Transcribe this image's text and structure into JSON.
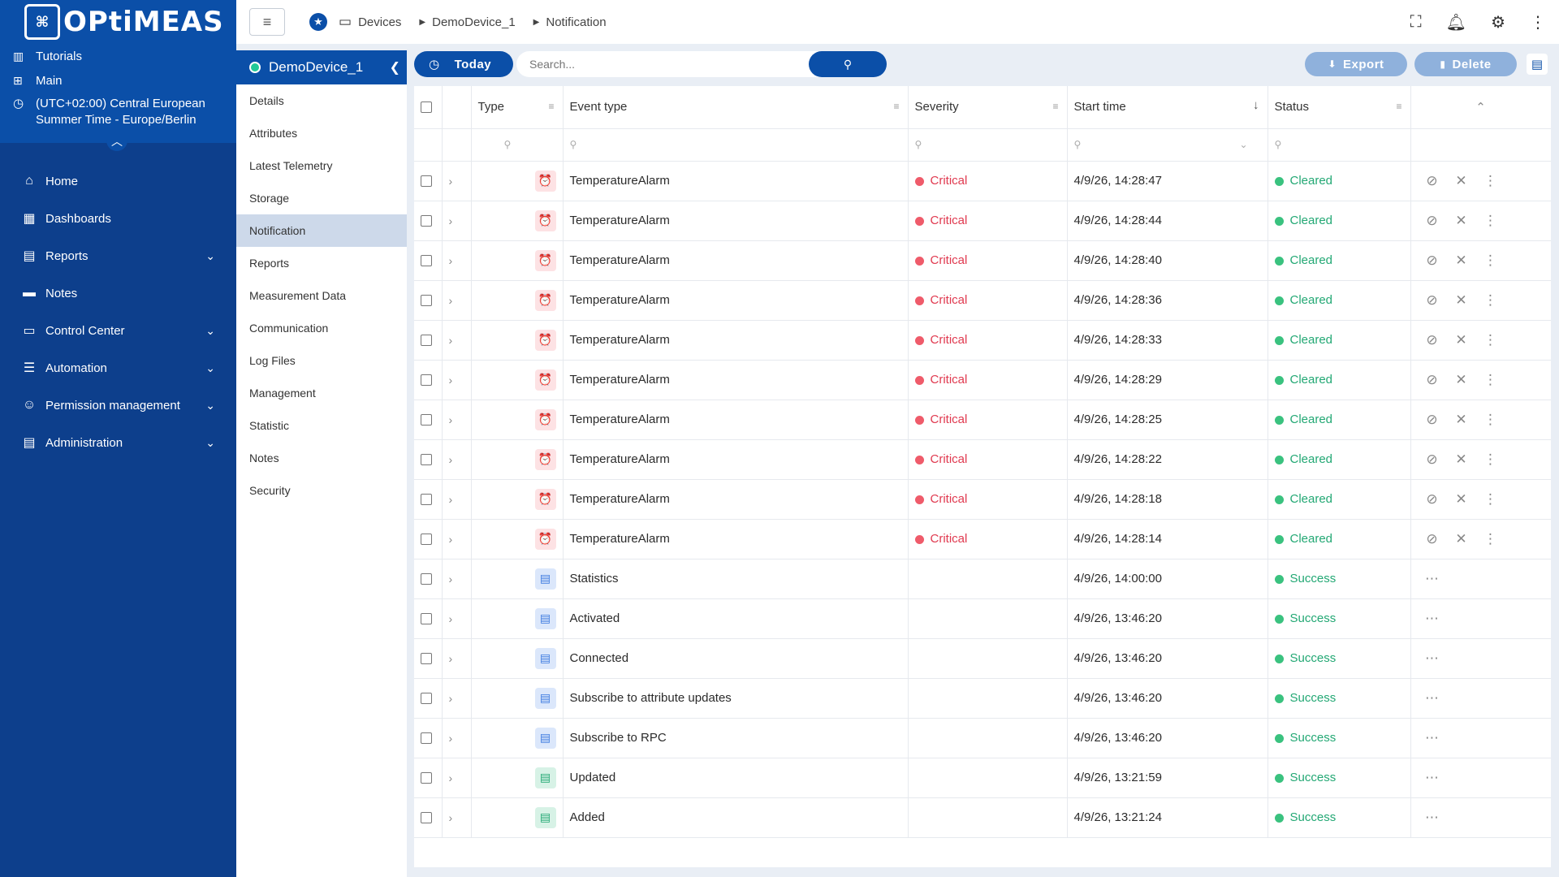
{
  "brand": {
    "chip": "⌘",
    "name": "OPtiMEAS"
  },
  "top_links": [
    {
      "label": "Tutorials",
      "icon": "book-icon"
    },
    {
      "label": "Main",
      "icon": "sitemap-icon"
    }
  ],
  "timezone": {
    "line1": "(UTC+02:00) Central European",
    "line2": "Summer Time - Europe/Berlin",
    "icon": "clock-icon"
  },
  "nav": [
    {
      "label": "Home",
      "icon": "home-icon",
      "glyph": "⌂",
      "expandable": false
    },
    {
      "label": "Dashboards",
      "icon": "dashboard-icon",
      "glyph": "▦",
      "expandable": false
    },
    {
      "label": "Reports",
      "icon": "clipboard-icon",
      "glyph": "▤",
      "expandable": true
    },
    {
      "label": "Notes",
      "icon": "note-icon",
      "glyph": "▬",
      "expandable": false
    },
    {
      "label": "Control Center",
      "icon": "devices-icon",
      "glyph": "▭",
      "expandable": true
    },
    {
      "label": "Automation",
      "icon": "tune-icon",
      "glyph": "☰",
      "expandable": true
    },
    {
      "label": "Permission management",
      "icon": "people-icon",
      "glyph": "☺",
      "expandable": true
    },
    {
      "label": "Administration",
      "icon": "document-icon",
      "glyph": "▤",
      "expandable": true
    }
  ],
  "breadcrumb": [
    "Devices",
    "DemoDevice_1",
    "Notification"
  ],
  "device": {
    "name": "DemoDevice_1"
  },
  "detail_nav": [
    "Details",
    "Attributes",
    "Latest Telemetry",
    "Storage",
    "Notification",
    "Reports",
    "Measurement Data",
    "Communication",
    "Log Files",
    "Management",
    "Statistic",
    "Notes",
    "Security"
  ],
  "detail_nav_active": "Notification",
  "toolbar": {
    "today": "Today",
    "search_placeholder": "Search...",
    "export": "Export",
    "delete": "Delete"
  },
  "columns": {
    "type": "Type",
    "event_type": "Event type",
    "severity": "Severity",
    "start_time": "Start time",
    "status": "Status"
  },
  "rows": [
    {
      "kind": "alarm",
      "event": "TemperatureAlarm",
      "severity": "Critical",
      "time": "4/9/26, 14:28:47",
      "status": "Cleared"
    },
    {
      "kind": "alarm",
      "event": "TemperatureAlarm",
      "severity": "Critical",
      "time": "4/9/26, 14:28:44",
      "status": "Cleared"
    },
    {
      "kind": "alarm",
      "event": "TemperatureAlarm",
      "severity": "Critical",
      "time": "4/9/26, 14:28:40",
      "status": "Cleared"
    },
    {
      "kind": "alarm",
      "event": "TemperatureAlarm",
      "severity": "Critical",
      "time": "4/9/26, 14:28:36",
      "status": "Cleared"
    },
    {
      "kind": "alarm",
      "event": "TemperatureAlarm",
      "severity": "Critical",
      "time": "4/9/26, 14:28:33",
      "status": "Cleared"
    },
    {
      "kind": "alarm",
      "event": "TemperatureAlarm",
      "severity": "Critical",
      "time": "4/9/26, 14:28:29",
      "status": "Cleared"
    },
    {
      "kind": "alarm",
      "event": "TemperatureAlarm",
      "severity": "Critical",
      "time": "4/9/26, 14:28:25",
      "status": "Cleared"
    },
    {
      "kind": "alarm",
      "event": "TemperatureAlarm",
      "severity": "Critical",
      "time": "4/9/26, 14:28:22",
      "status": "Cleared"
    },
    {
      "kind": "alarm",
      "event": "TemperatureAlarm",
      "severity": "Critical",
      "time": "4/9/26, 14:28:18",
      "status": "Cleared"
    },
    {
      "kind": "alarm",
      "event": "TemperatureAlarm",
      "severity": "Critical",
      "time": "4/9/26, 14:28:14",
      "status": "Cleared"
    },
    {
      "kind": "stat",
      "event": "Statistics",
      "severity": "",
      "time": "4/9/26, 14:00:00",
      "status": "Success"
    },
    {
      "kind": "stat",
      "event": "Activated",
      "severity": "",
      "time": "4/9/26, 13:46:20",
      "status": "Success"
    },
    {
      "kind": "stat",
      "event": "Connected",
      "severity": "",
      "time": "4/9/26, 13:46:20",
      "status": "Success"
    },
    {
      "kind": "stat",
      "event": "Subscribe to attribute updates",
      "severity": "",
      "time": "4/9/26, 13:46:20",
      "status": "Success"
    },
    {
      "kind": "stat",
      "event": "Subscribe to RPC",
      "severity": "",
      "time": "4/9/26, 13:46:20",
      "status": "Success"
    },
    {
      "kind": "upd",
      "event": "Updated",
      "severity": "",
      "time": "4/9/26, 13:21:59",
      "status": "Success"
    },
    {
      "kind": "upd",
      "event": "Added",
      "severity": "",
      "time": "4/9/26, 13:21:24",
      "status": "Success"
    }
  ],
  "colors": {
    "primary": "#0b4fa8",
    "sidebar": "#0d3f8c",
    "critical": "#e0394f",
    "success": "#23a874"
  }
}
